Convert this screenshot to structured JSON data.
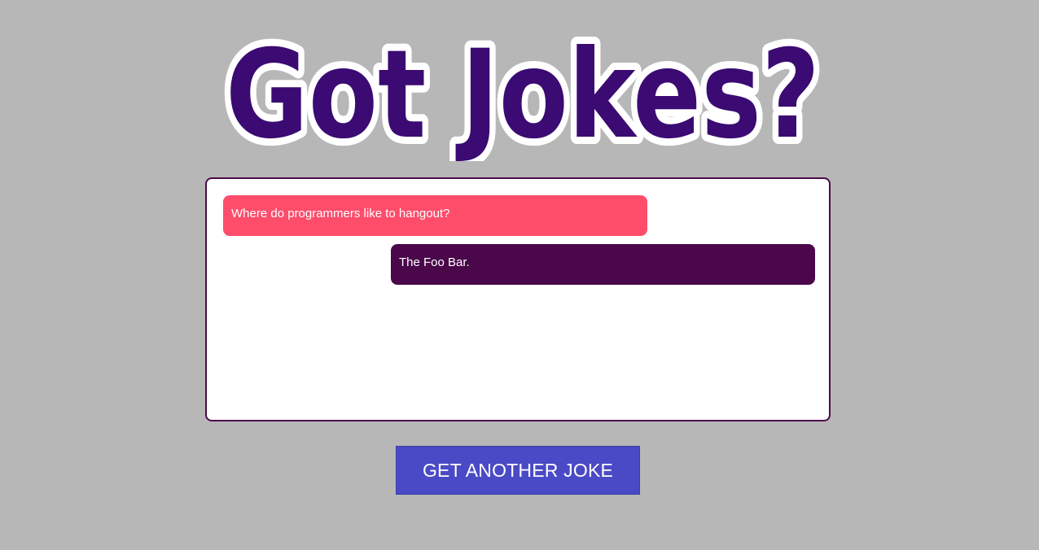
{
  "header": {
    "logo_text": "Got Jokes?"
  },
  "chat": {
    "question": "Where do programmers like to hangout?",
    "answer": "The Foo Bar."
  },
  "actions": {
    "get_joke_label": "GET ANOTHER JOKE"
  },
  "colors": {
    "background": "#b7b7b7",
    "logo_fill": "#3b0a72",
    "question_bubble": "#fd4d6b",
    "answer_bubble": "#4a074a",
    "button": "#4a4ac6"
  }
}
